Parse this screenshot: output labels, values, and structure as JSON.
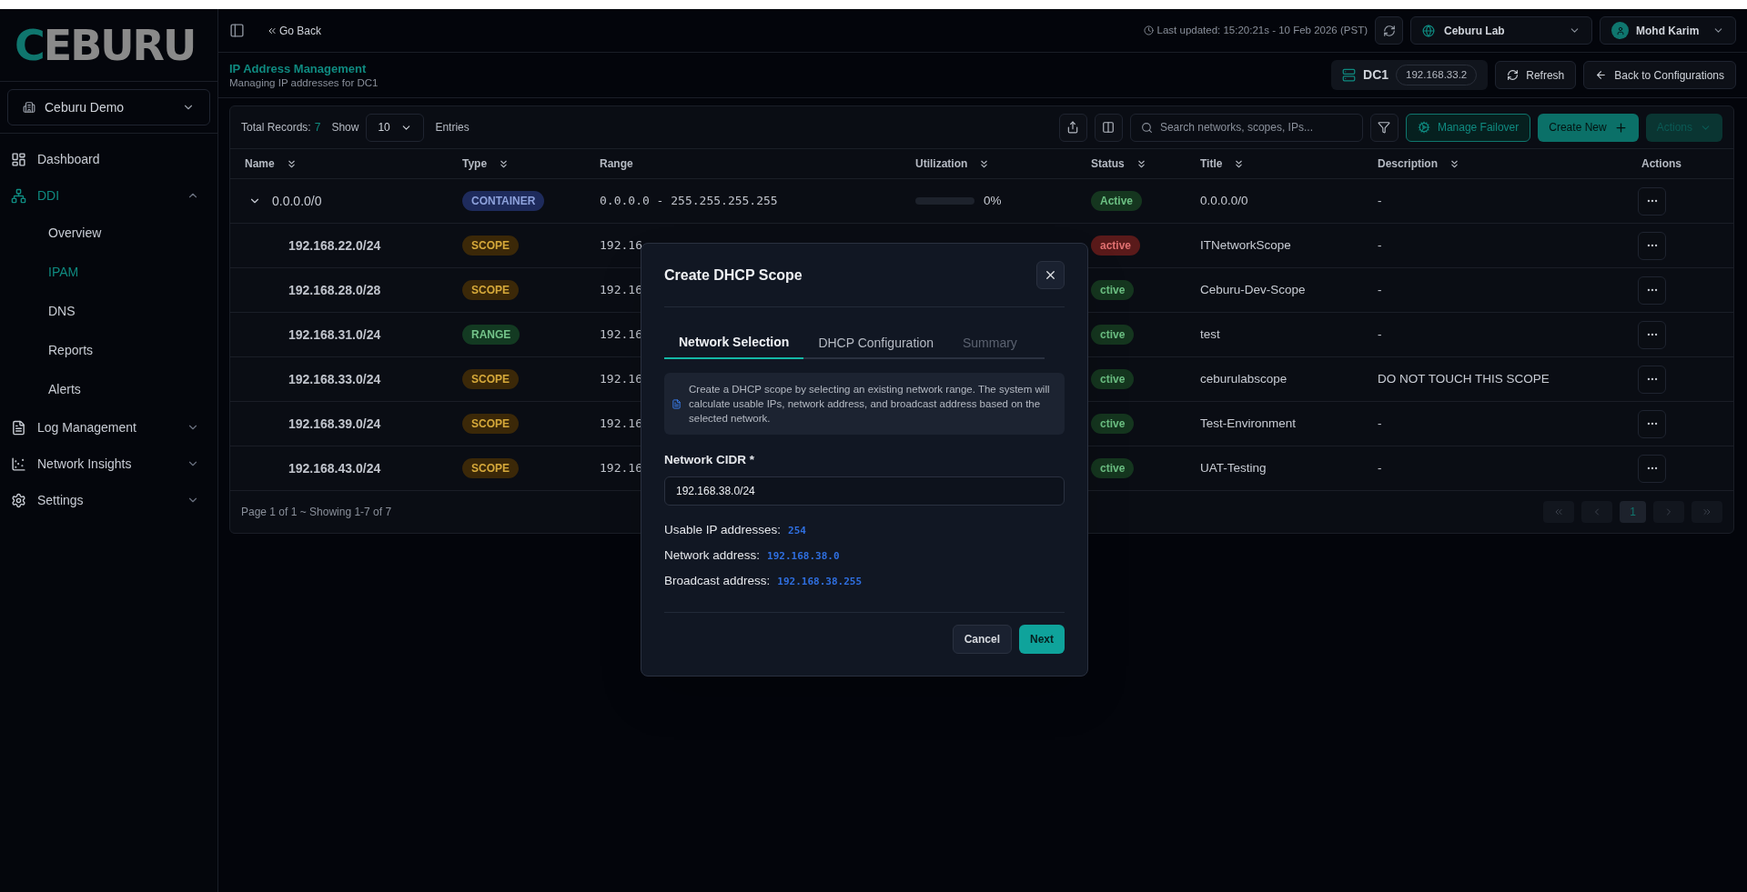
{
  "logo": {
    "accent": "C",
    "rest": "EBURU"
  },
  "org_select": {
    "value": "Ceburu Demo"
  },
  "sidebar": {
    "items": [
      {
        "label": "Dashboard",
        "kind": "link",
        "selected": false
      },
      {
        "label": "DDI",
        "kind": "group",
        "selected": true,
        "expanded": true,
        "children": [
          {
            "label": "Overview",
            "selected": false
          },
          {
            "label": "IPAM",
            "selected": true
          },
          {
            "label": "DNS",
            "selected": false
          },
          {
            "label": "Reports",
            "selected": false
          },
          {
            "label": "Alerts",
            "selected": false
          }
        ]
      },
      {
        "label": "Log Management",
        "kind": "group",
        "selected": false,
        "expanded": false
      },
      {
        "label": "Network Insights",
        "kind": "group",
        "selected": false,
        "expanded": false
      },
      {
        "label": "Settings",
        "kind": "group",
        "selected": false,
        "expanded": false
      }
    ]
  },
  "topbar": {
    "back": "Go Back",
    "last_updated": "Last updated: 15:20:21s - 10 Feb 2026 (PST)",
    "site": "Ceburu Lab",
    "user": "Mohd Karim"
  },
  "header": {
    "title": "IP Address Management",
    "subtitle": "Managing IP addresses for DC1",
    "server": "DC1",
    "server_ip": "192.168.33.2",
    "buttons": [
      "Refresh",
      "Back to Configurations"
    ]
  },
  "toolbar": {
    "total_label": "Total Records:",
    "total": "7",
    "show": "Show",
    "page_size": "10",
    "entries": "Entries",
    "search_placeholder": "Search networks, scopes, IPs...",
    "manage_failover": "Manage Failover",
    "create_new": "Create New",
    "actions": {
      "label": "Actions",
      "disabled": true
    }
  },
  "table": {
    "columns": [
      {
        "label": "Name",
        "sortable": true
      },
      {
        "label": "Type",
        "sortable": true
      },
      {
        "label": "Range",
        "sortable": false
      },
      {
        "label": "Utilization",
        "sortable": true
      },
      {
        "label": "Status",
        "sortable": true
      },
      {
        "label": "Title",
        "sortable": true
      },
      {
        "label": "Description",
        "sortable": true
      },
      {
        "label": "Actions",
        "sortable": false
      }
    ],
    "rows": [
      {
        "name": "0.0.0.0/0",
        "expanded": true,
        "type": {
          "label": "CONTAINER",
          "kind": "container",
          "color": "#1e2b5c"
        },
        "range": "0.0.0.0 - 255.255.255.255",
        "utilization": {
          "level": 0,
          "text": "0%"
        },
        "status": {
          "label": "Active",
          "kind": "active",
          "color": "#15361f"
        },
        "title": "0.0.0.0/0",
        "description": "-",
        "children": [
          {
            "name": "192.168.22.0/24",
            "type": {
              "label": "SCOPE",
              "kind": "scope",
              "color": "#3b2808"
            },
            "range": "192.16",
            "status": {
              "label": "active",
              "kind": "inactive",
              "color": "#5a1a1a"
            },
            "title": "ITNetworkScope",
            "description": "-"
          },
          {
            "name": "192.168.28.0/28",
            "type": {
              "label": "SCOPE",
              "kind": "scope",
              "color": "#3b2808"
            },
            "range": "192.16",
            "status": {
              "label": "ctive",
              "kind": "active",
              "color": "#15361f"
            },
            "title": "Ceburu-Dev-Scope",
            "description": "-"
          },
          {
            "name": "192.168.31.0/24",
            "type": {
              "label": "RANGE",
              "kind": "range",
              "color": "#133a22"
            },
            "range": "192.16",
            "status": {
              "label": "ctive",
              "kind": "active",
              "color": "#15361f"
            },
            "title": "test",
            "description": "-"
          },
          {
            "name": "192.168.33.0/24",
            "type": {
              "label": "SCOPE",
              "kind": "scope",
              "color": "#3b2808"
            },
            "range": "192.16",
            "status": {
              "label": "ctive",
              "kind": "active",
              "color": "#15361f"
            },
            "title": "ceburulabscope",
            "description": "DO NOT TOUCH THIS SCOPE"
          },
          {
            "name": "192.168.39.0/24",
            "type": {
              "label": "SCOPE",
              "kind": "scope",
              "color": "#3b2808"
            },
            "range": "192.16",
            "status": {
              "label": "ctive",
              "kind": "active",
              "color": "#15361f"
            },
            "title": "Test-Environment",
            "description": "-"
          },
          {
            "name": "192.168.43.0/24",
            "type": {
              "label": "SCOPE",
              "kind": "scope",
              "color": "#3b2808"
            },
            "range": "192.16",
            "status": {
              "label": "ctive",
              "kind": "active",
              "color": "#15361f"
            },
            "title": "UAT-Testing",
            "description": "-"
          }
        ]
      }
    ]
  },
  "footer": {
    "summary": "Page 1 of 1 ~ Showing 1-7 of 7",
    "pages": [
      {
        "label": "1",
        "selected": true
      }
    ]
  },
  "modal": {
    "title": "Create DHCP Scope",
    "tabs": [
      {
        "label": "Network Selection",
        "selected": true,
        "disabled": false
      },
      {
        "label": "DHCP Configuration",
        "selected": false,
        "disabled": false
      },
      {
        "label": "Summary",
        "selected": false,
        "disabled": true
      }
    ],
    "info": "Create a DHCP scope by selecting an existing network range. The system will calculate usable IPs, network address, and broadcast address based on the selected network.",
    "field": {
      "label": "Network CIDR *",
      "value": "192.168.38.0/24"
    },
    "stats": [
      {
        "label": "Usable IP addresses:",
        "value": "254"
      },
      {
        "label": "Network address:",
        "value": "192.168.38.0"
      },
      {
        "label": "Broadcast address:",
        "value": "192.168.38.255"
      }
    ],
    "buttons": {
      "cancel": "Cancel",
      "next": "Next"
    }
  }
}
